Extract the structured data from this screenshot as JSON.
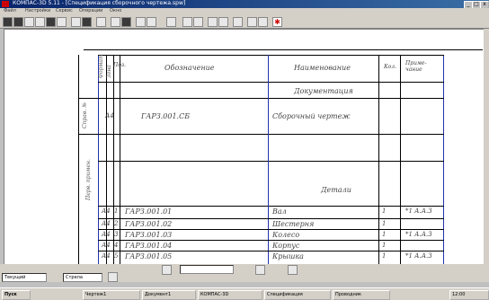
{
  "window": {
    "title": "КОМПАС-3D 5.11 - [Спецификация сборочного чертежа.spw]",
    "min_label": "_",
    "max_label": "□",
    "close_label": "x"
  },
  "menu": {
    "items": [
      "Файл",
      "Настройки",
      "Сервис",
      "Операции",
      "Окно"
    ]
  },
  "spec": {
    "headers": [
      "Формат",
      "Зона",
      "Поз.",
      "Обозначение",
      "Наименование",
      "Кол.",
      "Приме-чание"
    ],
    "section_docs": "Документация",
    "section_details": "Детали",
    "doc_row": {
      "zone": "А4",
      "designation": "ГАРЗ.001.СБ",
      "name": "Сборочный чертеж"
    },
    "rows": [
      {
        "zone": "А4",
        "pos": "1",
        "designation": "ГАРЗ.001.01",
        "name": "Вал",
        "qty": "1",
        "note": "*1 А.А.З"
      },
      {
        "zone": "А4",
        "pos": "2",
        "designation": "ГАРЗ.001.02",
        "name": "Шестерня",
        "qty": "1",
        "note": ""
      },
      {
        "zone": "А4",
        "pos": "3",
        "designation": "ГАРЗ.001.03",
        "name": "Колесо",
        "qty": "1",
        "note": "*1 А.А.З"
      },
      {
        "zone": "А4",
        "pos": "4",
        "designation": "ГАРЗ.001.04",
        "name": "Корпус",
        "qty": "1",
        "note": ""
      },
      {
        "zone": "А4",
        "pos": "5",
        "designation": "ГАРЗ.001.05",
        "name": "Крышка",
        "qty": "1",
        "note": "*1 А.А.З"
      }
    ],
    "side_label_1": "Справ. №",
    "side_label_2": "Перв. примен."
  },
  "statusbar": {
    "field1": "Текущий",
    "field2": "Стрела",
    "info": ""
  },
  "taskbar": {
    "start": "Пуск",
    "tasks": [
      "Чертеж1",
      "Документ1",
      "КОМПАС-3D",
      "Спецификация",
      "Проводник"
    ],
    "clock": "12:00"
  }
}
